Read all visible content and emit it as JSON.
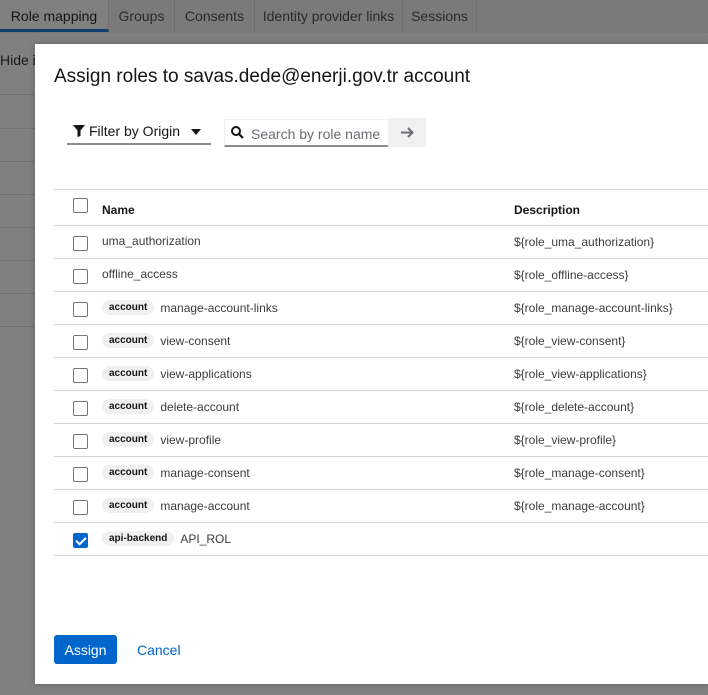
{
  "background": {
    "tabs": [
      {
        "label": "Role mapping",
        "active": true
      },
      {
        "label": "Groups",
        "active": false
      },
      {
        "label": "Consents",
        "active": false
      },
      {
        "label": "Identity provider links",
        "active": false
      },
      {
        "label": "Sessions",
        "active": false
      }
    ],
    "hide_text": "Hide in"
  },
  "modal": {
    "title": "Assign roles to savas.dede@enerji.gov.tr account",
    "filter_label": "Filter by Origin",
    "search_placeholder": "Search by role name",
    "search_value": "",
    "columns": {
      "name": "Name",
      "description": "Description"
    },
    "rows": [
      {
        "badge": "",
        "name": "uma_authorization",
        "description": "${role_uma_authorization}",
        "checked": false
      },
      {
        "badge": "",
        "name": "offline_access",
        "description": "${role_offline-access}",
        "checked": false
      },
      {
        "badge": "account",
        "name": "manage-account-links",
        "description": "${role_manage-account-links}",
        "checked": false
      },
      {
        "badge": "account",
        "name": "view-consent",
        "description": "${role_view-consent}",
        "checked": false
      },
      {
        "badge": "account",
        "name": "view-applications",
        "description": "${role_view-applications}",
        "checked": false
      },
      {
        "badge": "account",
        "name": "delete-account",
        "description": "${role_delete-account}",
        "checked": false
      },
      {
        "badge": "account",
        "name": "view-profile",
        "description": "${role_view-profile}",
        "checked": false
      },
      {
        "badge": "account",
        "name": "manage-consent",
        "description": "${role_manage-consent}",
        "checked": false
      },
      {
        "badge": "account",
        "name": "manage-account",
        "description": "${role_manage-account}",
        "checked": false
      },
      {
        "badge": "api-backend",
        "name": "API_ROL",
        "description": "",
        "checked": true
      }
    ],
    "assign_label": "Assign",
    "cancel_label": "Cancel",
    "colors": {
      "primary": "#0066cc",
      "badge_bg": "#f0f0f0",
      "border": "#d2d2d2"
    }
  }
}
